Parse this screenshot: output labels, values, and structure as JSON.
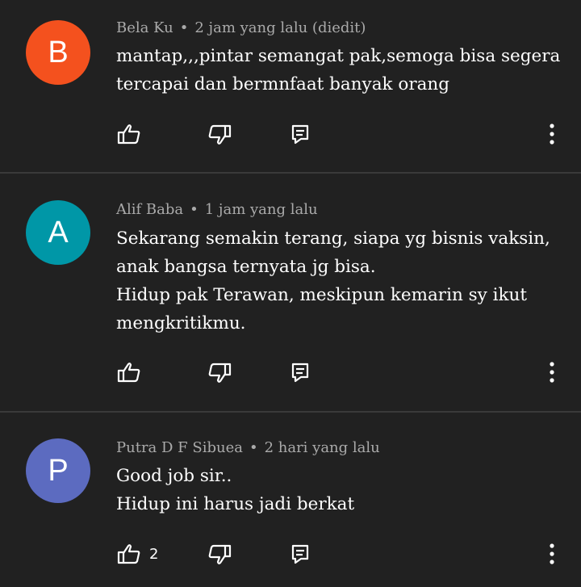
{
  "comments": [
    {
      "avatar_letter": "B",
      "avatar_color": "#f4511e",
      "author": "Bela Ku",
      "time": "2 jam yang lalu (diedit)",
      "lines": [
        "mantap,,,pintar semangat pak,semoga  bisa segera",
        "tercapai dan bermnfaat banyak orang"
      ],
      "like_count": ""
    },
    {
      "avatar_letter": "A",
      "avatar_color": "#0097a7",
      "author": "Alif Baba",
      "time": "1 jam yang lalu",
      "lines": [
        "Sekarang semakin terang, siapa yg bisnis vaksin,",
        "anak bangsa ternyata jg bisa.",
        "Hidup pak Terawan, meskipun kemarin sy ikut",
        "mengkritikmu."
      ],
      "like_count": ""
    },
    {
      "avatar_letter": "P",
      "avatar_color": "#5c6bc0",
      "author": "Putra D F Sibuea",
      "time": "2 hari yang lalu",
      "lines": [
        "Good job sir..",
        "Hidup ini harus jadi berkat"
      ],
      "like_count": "2"
    }
  ],
  "meta_separator": "•",
  "icons": {
    "like": "thumb-up-icon",
    "dislike": "thumb-down-icon",
    "reply": "reply-comment-icon",
    "menu": "more-vertical-icon"
  }
}
